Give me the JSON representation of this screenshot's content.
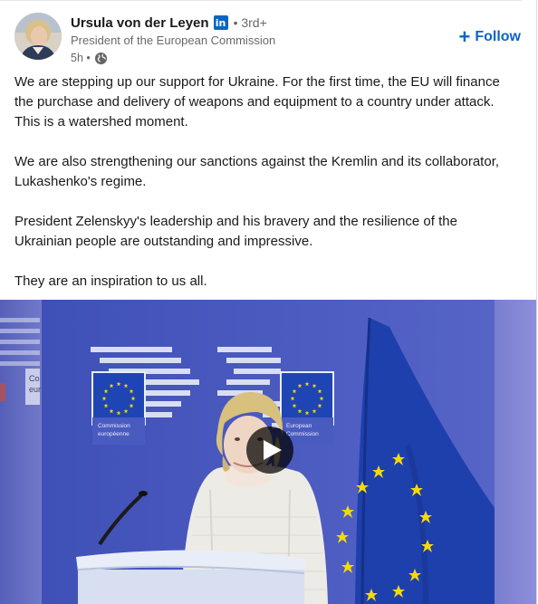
{
  "post": {
    "author": {
      "name": "Ursula von der Leyen",
      "badge_letter": "in",
      "degree": "• 3rd+",
      "headline": "President of the European Commission",
      "time": "5h •"
    },
    "follow_label": "Follow",
    "paragraphs": [
      "We are stepping up our support for Ukraine. For the first time, the EU will finance the purchase and delivery of weapons and equipment to a country under attack. This is a watershed moment.",
      "We are also strengthening our sanctions against the Kremlin and its collaborator, Lukashenko's regime.",
      "President Zelenskyy's leadership and his bravery and the resilience of the Ukrainian people are outstanding and impressive.",
      "They are an inspiration to us all."
    ],
    "video": {
      "sign_left_line1": "Commission",
      "sign_left_line2": "européenne",
      "sign_right_line1": "European",
      "sign_right_line2": "Commission",
      "edge_sign_line1": "Co",
      "edge_sign_line2": "eur"
    }
  },
  "icons": {
    "globe": "globe-icon",
    "play": "play-icon",
    "plus": "plus-icon",
    "linkedin": "linkedin-icon"
  },
  "colors": {
    "accent": "#0a66c2",
    "eu_blue": "#1f44b4",
    "eu_star": "#f5d90a"
  }
}
